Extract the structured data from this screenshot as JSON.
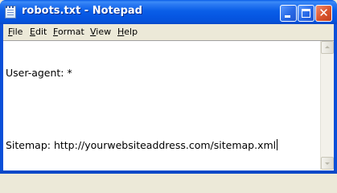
{
  "window": {
    "title": "robots.txt - Notepad",
    "accent": "#0a5ee8"
  },
  "icons": {
    "app": "notepad-icon",
    "minimize": "minimize-icon",
    "maximize": "maximize-icon",
    "close": "close-icon",
    "scroll_up": "scroll-up-arrow-icon",
    "scroll_down": "scroll-down-arrow-icon"
  },
  "titlebar_buttons": {
    "close_glyph": "✕"
  },
  "menu": [
    {
      "label_first": "F",
      "label_rest": "ile"
    },
    {
      "label_first": "E",
      "label_rest": "dit"
    },
    {
      "label_first": "",
      "label_rest": "F",
      "label_tail": "ormat"
    },
    {
      "label_first": "V",
      "label_rest": "iew"
    },
    {
      "label_first": "H",
      "label_rest": "elp"
    }
  ],
  "editor": {
    "lines": [
      "User-agent: *",
      "",
      "Sitemap: http://yourwebsiteaddress.com/sitemap.xml"
    ]
  }
}
